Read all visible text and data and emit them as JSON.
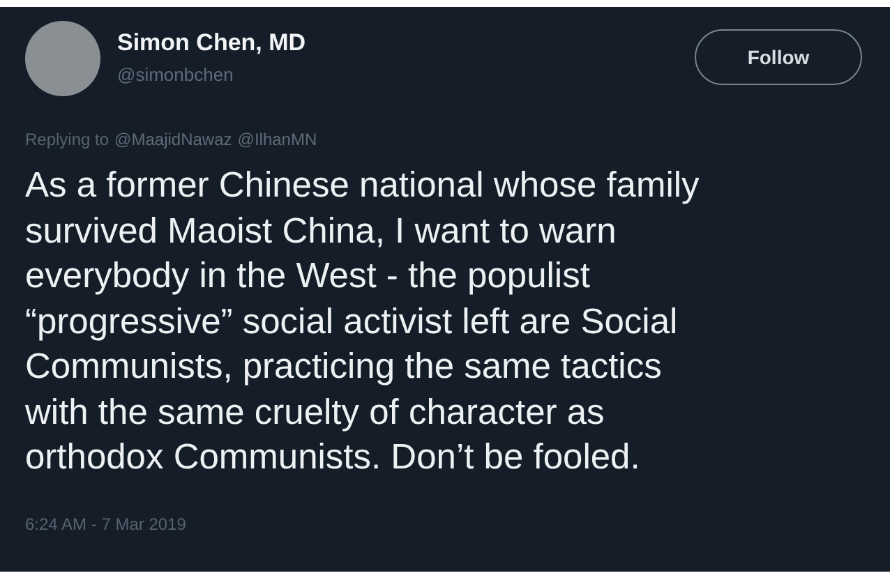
{
  "author": {
    "name": "Simon Chen, MD",
    "handle": "@simonbchen"
  },
  "follow_button": {
    "label": "Follow"
  },
  "reply_line": {
    "prefix": "Replying to",
    "mentions": [
      "@MaajidNawaz",
      "@IlhanMN"
    ]
  },
  "body": "As a former Chinese national whose family\nsurvived Maoist China, I want to warn\neverybody in the West - the populist\n“progressive” social activist left are Social\nCommunists, practicing the same tactics\nwith the same cruelty of character as\northodox Communists.  Don’t be fooled.",
  "timestamp": "6:24 AM - 7 Mar 2019"
}
